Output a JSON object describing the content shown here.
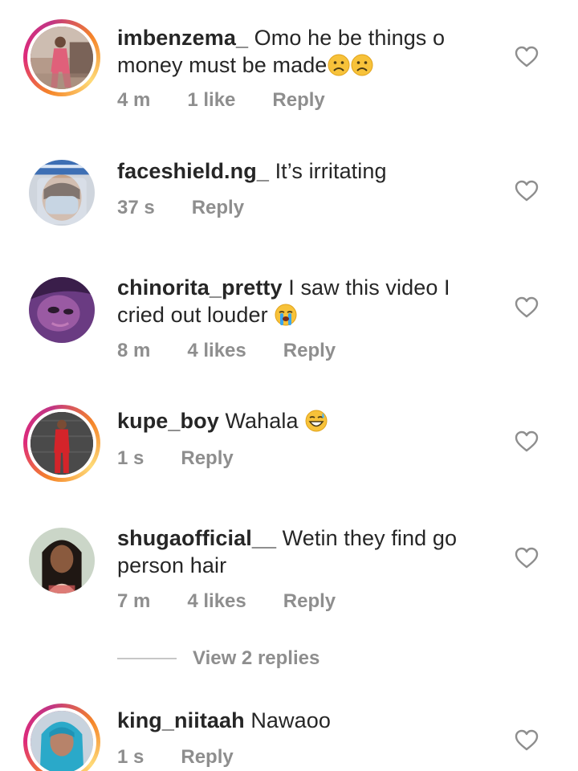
{
  "comments": [
    {
      "username": "imbenzema_",
      "text": " Omo he be things o money must be made",
      "emoji": [
        "frowning-face",
        "frowning-face"
      ],
      "time": "4 m",
      "likes": "1 like",
      "reply": "Reply",
      "story_ring": true
    },
    {
      "username": "faceshield.ng_",
      "text": " It’s irritating",
      "time": "37 s",
      "reply": "Reply",
      "story_ring": false
    },
    {
      "username": "chinorita_pretty",
      "text": " I saw this video I cried out louder ",
      "emoji": [
        "loudly-crying-face"
      ],
      "time": "8 m",
      "likes": "4 likes",
      "reply": "Reply",
      "story_ring": false
    },
    {
      "username": "kupe_boy",
      "text": " Wahala ",
      "emoji": [
        "grinning-sweat-face"
      ],
      "time": "1 s",
      "reply": "Reply",
      "story_ring": true
    },
    {
      "username": "shugaofficial__",
      "text": " Wetin they find go person hair",
      "time": "7 m",
      "likes": "4 likes",
      "reply": "Reply",
      "story_ring": false
    },
    {
      "username": "king_niitaah",
      "text": " Nawaoo",
      "time": "1 s",
      "reply": "Reply",
      "story_ring": true
    }
  ],
  "view_replies": "View 2 replies",
  "colors": {
    "text": "#262626",
    "meta": "#8e8e8e",
    "divider": "#c7c7c7"
  },
  "icons": {
    "like": "heart-outline-icon"
  }
}
